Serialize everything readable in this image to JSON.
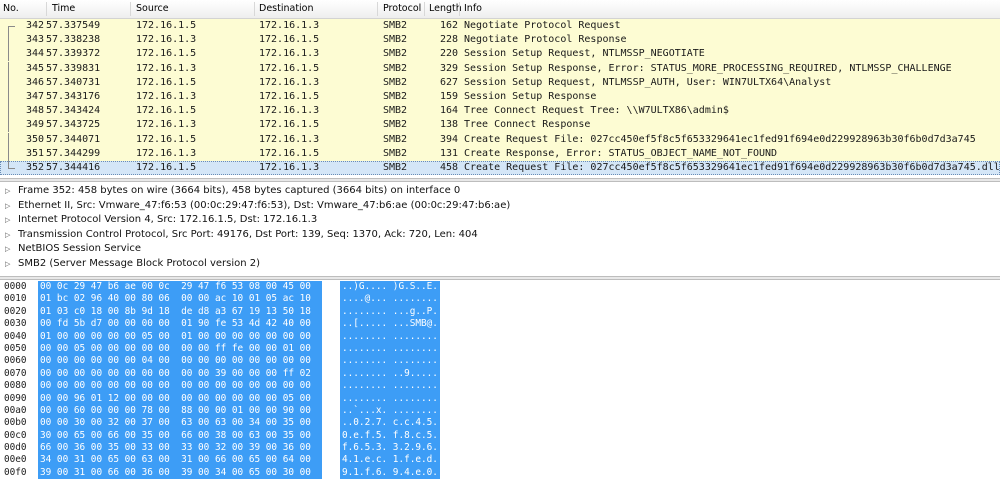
{
  "packet_list": {
    "columns": {
      "no": "No.",
      "time": "Time",
      "source": "Source",
      "destination": "Destination",
      "protocol": "Protocol",
      "length": "Length",
      "info": "Info"
    },
    "rows": [
      {
        "no": "342",
        "time": "57.337549",
        "src": "172.16.1.5",
        "dst": "172.16.1.3",
        "proto": "SMB2",
        "len": "162",
        "info": "Negotiate Protocol Request"
      },
      {
        "no": "343",
        "time": "57.338238",
        "src": "172.16.1.3",
        "dst": "172.16.1.5",
        "proto": "SMB2",
        "len": "228",
        "info": "Negotiate Protocol Response"
      },
      {
        "no": "344",
        "time": "57.339372",
        "src": "172.16.1.5",
        "dst": "172.16.1.3",
        "proto": "SMB2",
        "len": "220",
        "info": "Session Setup Request, NTLMSSP_NEGOTIATE"
      },
      {
        "no": "345",
        "time": "57.339831",
        "src": "172.16.1.3",
        "dst": "172.16.1.5",
        "proto": "SMB2",
        "len": "329",
        "info": "Session Setup Response, Error: STATUS_MORE_PROCESSING_REQUIRED, NTLMSSP_CHALLENGE"
      },
      {
        "no": "346",
        "time": "57.340731",
        "src": "172.16.1.5",
        "dst": "172.16.1.3",
        "proto": "SMB2",
        "len": "627",
        "info": "Session Setup Request, NTLMSSP_AUTH, User: WIN7ULTX64\\Analyst"
      },
      {
        "no": "347",
        "time": "57.343176",
        "src": "172.16.1.3",
        "dst": "172.16.1.5",
        "proto": "SMB2",
        "len": "159",
        "info": "Session Setup Response"
      },
      {
        "no": "348",
        "time": "57.343424",
        "src": "172.16.1.5",
        "dst": "172.16.1.3",
        "proto": "SMB2",
        "len": "164",
        "info": "Tree Connect Request Tree: \\\\W7ULTX86\\admin$"
      },
      {
        "no": "349",
        "time": "57.343725",
        "src": "172.16.1.3",
        "dst": "172.16.1.5",
        "proto": "SMB2",
        "len": "138",
        "info": "Tree Connect Response"
      },
      {
        "no": "350",
        "time": "57.344071",
        "src": "172.16.1.5",
        "dst": "172.16.1.3",
        "proto": "SMB2",
        "len": "394",
        "info": "Create Request File: 027cc450ef5f8c5f653329641ec1fed91f694e0d229928963b30f6b0d7d3a745"
      },
      {
        "no": "351",
        "time": "57.344299",
        "src": "172.16.1.3",
        "dst": "172.16.1.5",
        "proto": "SMB2",
        "len": "131",
        "info": "Create Response, Error: STATUS_OBJECT_NAME_NOT_FOUND"
      },
      {
        "no": "352",
        "time": "57.344416",
        "src": "172.16.1.5",
        "dst": "172.16.1.3",
        "proto": "SMB2",
        "len": "458",
        "info": "Create Request File: 027cc450ef5f8c5f653329641ec1fed91f694e0d229928963b30f6b0d7d3a745.dll"
      }
    ]
  },
  "details": [
    "Frame 352: 458 bytes on wire (3664 bits), 458 bytes captured (3664 bits) on interface 0",
    "Ethernet II, Src: Vmware_47:f6:53 (00:0c:29:47:f6:53), Dst: Vmware_47:b6:ae (00:0c:29:47:b6:ae)",
    "Internet Protocol Version 4, Src: 172.16.1.5, Dst: 172.16.1.3",
    "Transmission Control Protocol, Src Port: 49176, Dst Port: 139, Seq: 1370, Ack: 720, Len: 404",
    "NetBIOS Session Service",
    "SMB2 (Server Message Block Protocol version 2)"
  ],
  "hex": [
    {
      "off": "0000",
      "bytes": "00 0c 29 47 b6 ae 00 0c  29 47 f6 53 08 00 45 00",
      "ascii": "..)G.... )G.S..E."
    },
    {
      "off": "0010",
      "bytes": "01 bc 02 96 40 00 80 06  00 00 ac 10 01 05 ac 10",
      "ascii": "....@... ........"
    },
    {
      "off": "0020",
      "bytes": "01 03 c0 18 00 8b 9d 18  de d8 a3 67 19 13 50 18",
      "ascii": "........ ...g..P."
    },
    {
      "off": "0030",
      "bytes": "00 fd 5b d7 00 00 00 00  01 90 fe 53 4d 42 40 00",
      "ascii": "..[..... ...SMB@."
    },
    {
      "off": "0040",
      "bytes": "01 00 00 00 00 00 05 00  01 00 00 00 00 00 00 00",
      "ascii": "........ ........"
    },
    {
      "off": "0050",
      "bytes": "00 00 05 00 00 00 00 00  00 00 ff fe 00 00 01 00",
      "ascii": "........ ........"
    },
    {
      "off": "0060",
      "bytes": "00 00 00 00 00 00 04 00  00 00 00 00 00 00 00 00",
      "ascii": "........ ........"
    },
    {
      "off": "0070",
      "bytes": "00 00 00 00 00 00 00 00  00 00 39 00 00 00 ff 02",
      "ascii": "........ ..9....."
    },
    {
      "off": "0080",
      "bytes": "00 00 00 00 00 00 00 00  00 00 00 00 00 00 00 00",
      "ascii": "........ ........"
    },
    {
      "off": "0090",
      "bytes": "00 00 96 01 12 00 00 00  00 00 00 00 00 00 05 00",
      "ascii": "........ ........"
    },
    {
      "off": "00a0",
      "bytes": "00 00 60 00 00 00 78 00  88 00 00 01 00 00 90 00",
      "ascii": "..`...x. ........"
    },
    {
      "off": "00b0",
      "bytes": "00 00 30 00 32 00 37 00  63 00 63 00 34 00 35 00",
      "ascii": "..0.2.7. c.c.4.5."
    },
    {
      "off": "00c0",
      "bytes": "30 00 65 00 66 00 35 00  66 00 38 00 63 00 35 00",
      "ascii": "0.e.f.5. f.8.c.5."
    },
    {
      "off": "00d0",
      "bytes": "66 00 36 00 35 00 33 00  33 00 32 00 39 00 36 00",
      "ascii": "f.6.5.3. 3.2.9.6."
    },
    {
      "off": "00e0",
      "bytes": "34 00 31 00 65 00 63 00  31 00 66 00 65 00 64 00",
      "ascii": "4.1.e.c. 1.f.e.d."
    },
    {
      "off": "00f0",
      "bytes": "39 00 31 00 66 00 36 00  39 00 34 00 65 00 30 00",
      "ascii": "9.1.f.6. 9.4.e.0."
    }
  ],
  "colors": {
    "smb_row": "#fdfcd3",
    "selected_row": "#d4e6f7",
    "hex_highlight": "#3d9df6"
  },
  "icons": {
    "expand": "triangle-right-icon"
  }
}
